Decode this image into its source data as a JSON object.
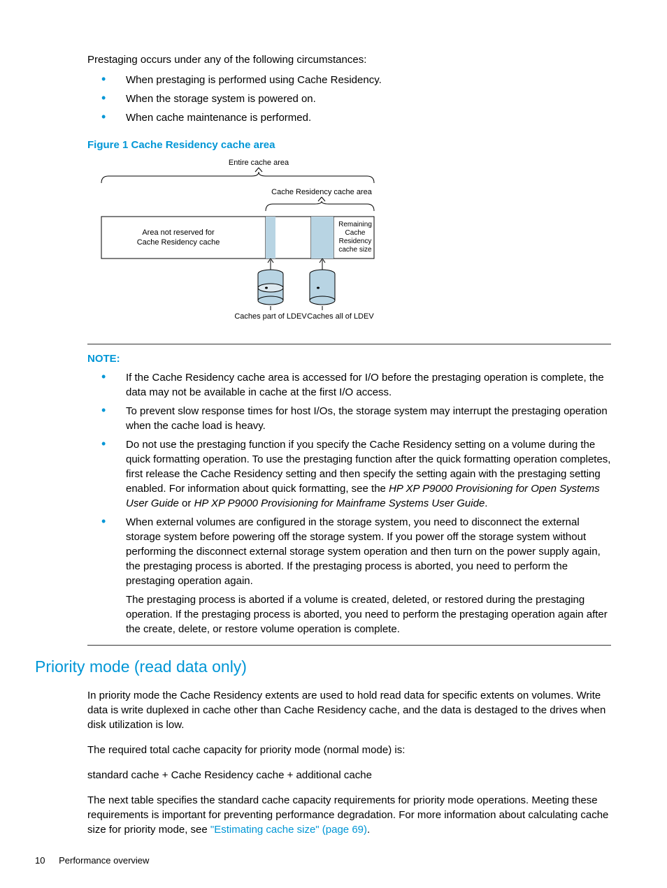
{
  "intro": "Prestaging occurs under any of the following circumstances:",
  "intro_bullets": [
    "When prestaging is performed using Cache Residency.",
    "When the storage system is powered on.",
    "When cache maintenance is performed."
  ],
  "figure": {
    "caption": "Figure 1 Cache Residency cache area",
    "labels": {
      "entire": "Entire cache area",
      "cr_area": "Cache Residency cache area",
      "not_reserved_1": "Area not reserved for",
      "not_reserved_2": "Cache Residency cache",
      "remaining_1": "Remaining",
      "remaining_2": "Cache",
      "remaining_3": "Residency",
      "remaining_4": "cache size",
      "caches_part": "Caches part of LDEV",
      "caches_all": "Caches all of LDEV"
    }
  },
  "note": {
    "heading": "NOTE:",
    "items": [
      {
        "text": "If the Cache Residency cache area is accessed for I/O before the prestaging operation is complete, the data may not be available in cache at the first I/O access."
      },
      {
        "text": "To prevent slow response times for host I/Os, the storage system may interrupt the prestaging operation when the cache load is heavy."
      },
      {
        "text_before": "Do not use the prestaging function if you specify the Cache Residency setting on a volume during the quick formatting operation. To use the prestaging function after the quick formatting operation completes, first release the Cache Residency setting and then specify the setting again with the prestaging setting enabled. For information about quick formatting, see the ",
        "italic1": "HP XP P9000 Provisioning for Open Systems User Guide",
        "mid": " or ",
        "italic2": "HP XP P9000 Provisioning for Mainframe Systems User Guide",
        "after": "."
      },
      {
        "text": "When external volumes are configured in the storage system, you need to disconnect the external storage system before powering off the storage system. If you power off the storage system without performing the disconnect external storage system operation and then turn on the power supply again, the prestaging process is aborted. If the prestaging process is aborted, you need to perform the prestaging operation again.",
        "followup": "The prestaging process is aborted if a volume is created, deleted, or restored during the prestaging operation. If the prestaging process is aborted, you need to perform the prestaging operation again after the create, delete, or restore volume operation is complete."
      }
    ]
  },
  "section2": {
    "heading": "Priority mode (read data only)",
    "p1": "In priority mode the Cache Residency extents are used to hold read data for specific extents on volumes. Write data is write duplexed in cache other than Cache Residency cache, and the data is destaged to the drives when disk utilization is low.",
    "p2": "The required total cache capacity for priority mode (normal mode) is:",
    "p3": "standard cache + Cache Residency cache + additional cache",
    "p4_before": "The next table specifies the standard cache capacity requirements for priority mode operations. Meeting these requirements is important for preventing performance degradation. For more information about calculating cache size for priority mode, see ",
    "p4_link": "\"Estimating cache size\" (page 69)",
    "p4_after": "."
  },
  "footer": {
    "page": "10",
    "title": "Performance overview"
  }
}
